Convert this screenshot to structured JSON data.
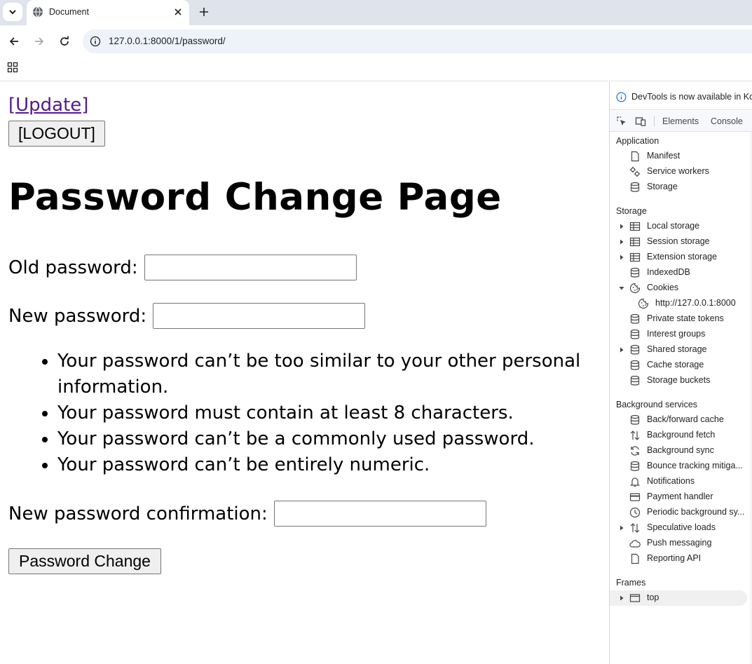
{
  "browser": {
    "tab_title": "Document",
    "url": "127.0.0.1:8000/1/password/"
  },
  "page": {
    "update_link": "[Update]",
    "logout_button": "[LOGOUT]",
    "title": "Password Change Page",
    "old_password_label": "Old password:",
    "new_password_label": "New password:",
    "help_items": [
      "Your password can’t be too similar to your other personal information.",
      "Your password must contain at least 8 characters.",
      "Your password can’t be a commonly used password.",
      "Your password can’t be entirely numeric."
    ],
    "confirm_label": "New password confirmation:",
    "submit_button": "Password Change"
  },
  "devtools": {
    "banner": "DevTools is now available in Korean",
    "tabs": [
      "Elements",
      "Console"
    ],
    "sections": {
      "application": "Application",
      "storage": "Storage",
      "background": "Background services",
      "frames": "Frames"
    },
    "application_items": [
      "Manifest",
      "Service workers",
      "Storage"
    ],
    "storage_items": [
      "Local storage",
      "Session storage",
      "Extension storage",
      "IndexedDB",
      "Cookies",
      "http://127.0.0.1:8000",
      "Private state tokens",
      "Interest groups",
      "Shared storage",
      "Cache storage",
      "Storage buckets"
    ],
    "background_items": [
      "Back/forward cache",
      "Background fetch",
      "Background sync",
      "Bounce tracking mitiga...",
      "Notifications",
      "Payment handler",
      "Periodic background sy...",
      "Speculative loads",
      "Push messaging",
      "Reporting API"
    ],
    "frames_items": [
      "top"
    ]
  },
  "colors": {
    "link_visited": "#551a8b",
    "tabstrip": "#dfe3eb",
    "omnibox": "#eef2f9",
    "devtools_info": "#1a73e8"
  }
}
